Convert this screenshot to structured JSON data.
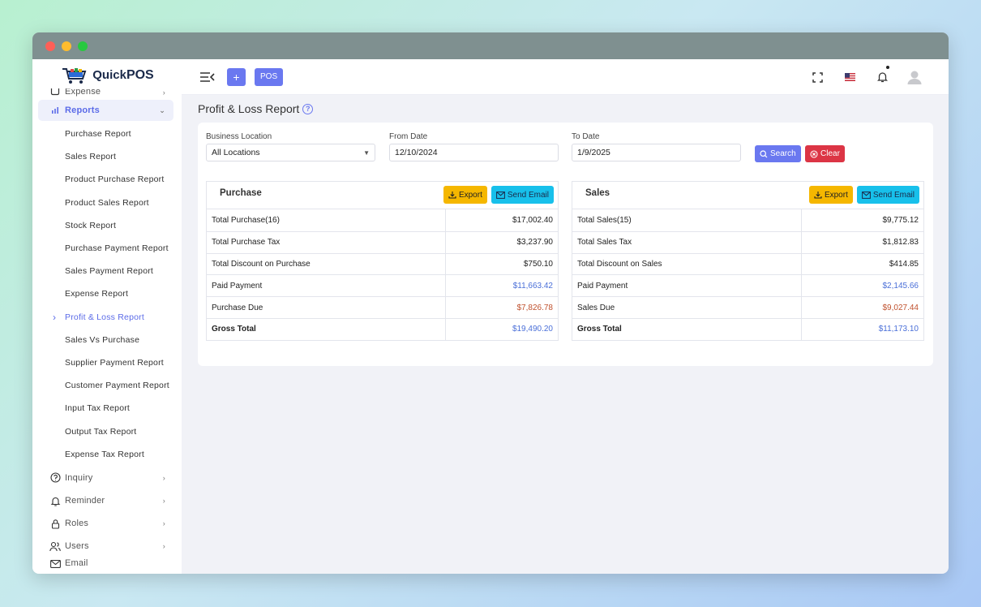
{
  "window": {
    "controls": [
      "close",
      "minimize",
      "maximize"
    ]
  },
  "brand": {
    "logo_text": "Quick",
    "logo_text_bold": "POS"
  },
  "sidebar": {
    "top_partial": "Expense",
    "reports_label": "Reports",
    "report_items": [
      "Purchase Report",
      "Sales Report",
      "Product Purchase Report",
      "Product Sales Report",
      "Stock Report",
      "Purchase Payment Report",
      "Sales Payment Report",
      "Expense Report",
      "Profit & Loss Report",
      "Sales Vs Purchase",
      "Supplier Payment Report",
      "Customer Payment Report",
      "Input Tax Report",
      "Output Tax Report",
      "Expense Tax Report"
    ],
    "active_item": "Profit & Loss Report",
    "sections": [
      "Inquiry",
      "Reminder",
      "Roles",
      "Users"
    ],
    "bottom_partial": "Email"
  },
  "topbar": {
    "plus_label": "+",
    "pos_label": "POS"
  },
  "page": {
    "title": "Profit & Loss Report"
  },
  "filters": {
    "location_label": "Business Location",
    "location_value": "All Locations",
    "from_label": "From Date",
    "from_value": "12/10/2024",
    "to_label": "To Date",
    "to_value": "1/9/2025",
    "search_label": "Search",
    "clear_label": "Clear"
  },
  "purchase": {
    "title": "Purchase",
    "export_label": "Export",
    "email_label": "Send Email",
    "rows": [
      {
        "label": "Total Purchase(16)",
        "value": "$17,002.40"
      },
      {
        "label": "Total Purchase Tax",
        "value": "$3,237.90"
      },
      {
        "label": "Total Discount on Purchase",
        "value": "$750.10"
      },
      {
        "label": "Paid Payment",
        "value": "$11,663.42"
      },
      {
        "label": "Purchase Due",
        "value": "$7,826.78"
      },
      {
        "label": "Gross Total",
        "value": "$19,490.20"
      }
    ]
  },
  "sales": {
    "title": "Sales",
    "export_label": "Export",
    "email_label": "Send Email",
    "rows": [
      {
        "label": "Total Sales(15)",
        "value": "$9,775.12"
      },
      {
        "label": "Total Sales Tax",
        "value": "$1,812.83"
      },
      {
        "label": "Total Discount on Sales",
        "value": "$414.85"
      },
      {
        "label": "Paid Payment",
        "value": "$2,145.66"
      },
      {
        "label": "Sales Due",
        "value": "$9,027.44"
      },
      {
        "label": "Gross Total",
        "value": "$11,173.10"
      }
    ]
  },
  "colors": {
    "accent": "#6a78f0",
    "export": "#f5b700",
    "email": "#17c0eb",
    "clear": "#dc3545",
    "paid": "#4a6fd8",
    "due": "#c0522f"
  }
}
